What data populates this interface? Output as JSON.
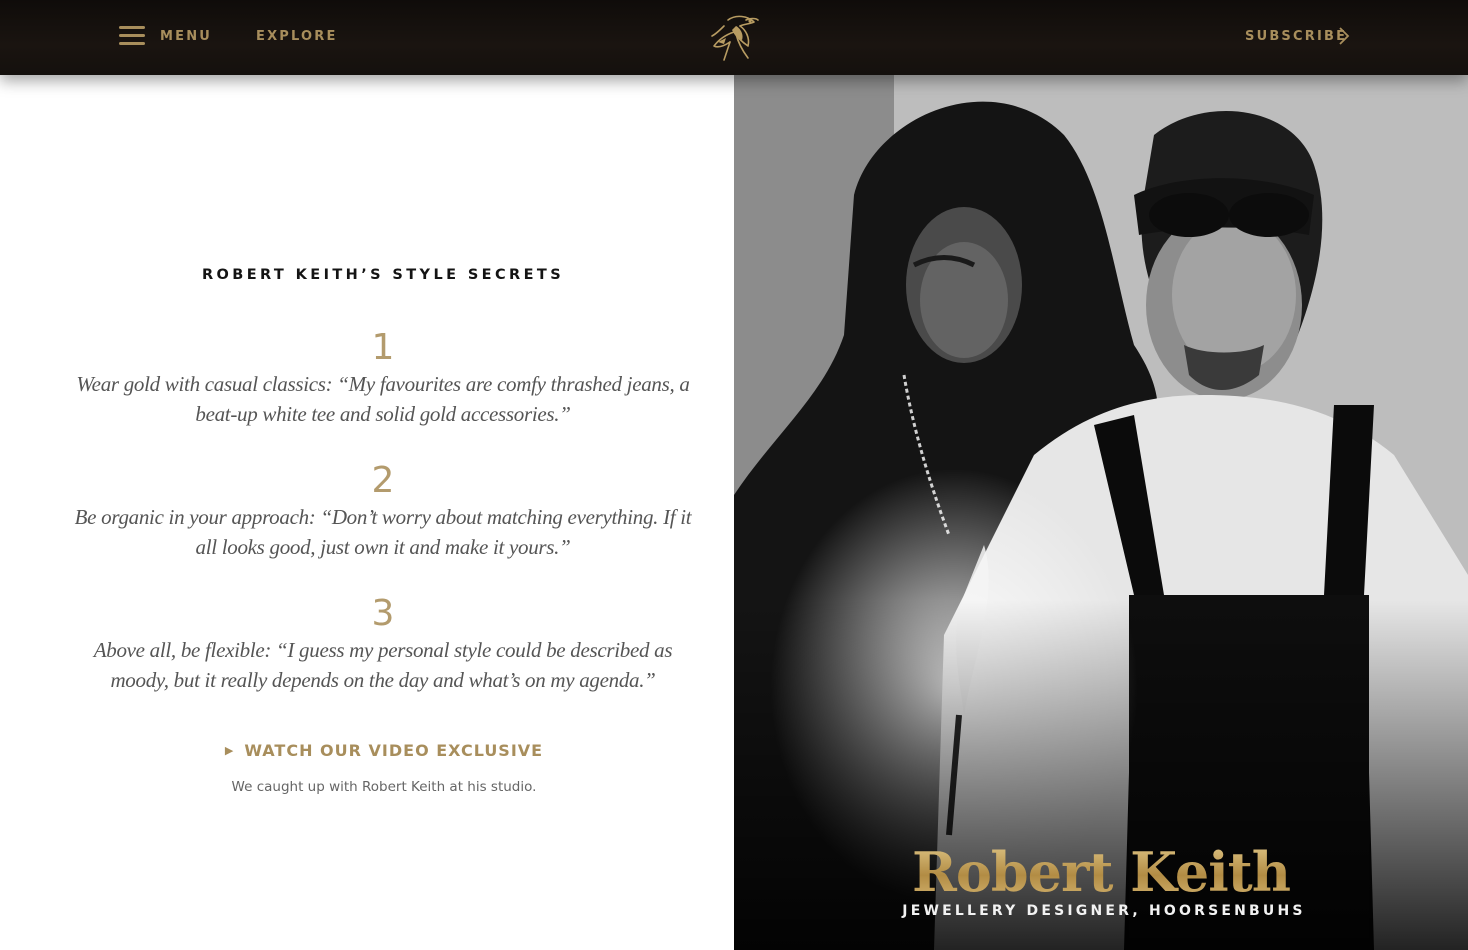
{
  "header": {
    "menu_label": "MENU",
    "explore_label": "EXPLORE",
    "subscribe_label": "SUBSCRIBE",
    "logo_icon": "bird-logo-icon",
    "accent_color": "#a88e5c"
  },
  "secrets": {
    "title": "ROBERT KEITH’S STYLE SECRETS",
    "items": [
      {
        "number": "1",
        "text": "Wear gold with casual classics: “My favourites are comfy thrashed jeans, a beat-up white tee and solid gold accessories.”"
      },
      {
        "number": "2",
        "text": "Be organic in your approach: “Don’t worry about matching everything. If it all looks good, just own it and make it yours.”"
      },
      {
        "number": "3",
        "text": "Above all, be flexible: “I guess my personal style could be described as moody, but it really depends on the day and what’s on my agenda.”"
      }
    ],
    "video_link": "WATCH OUR VIDEO EXCLUSIVE",
    "video_caption": "We caught up with Robert Keith at his studio."
  },
  "feature": {
    "name": "Robert Keith",
    "subtitle": "JEWELLERY DESIGNER, HOORSENBUHS",
    "name_color": "#c7a562"
  }
}
